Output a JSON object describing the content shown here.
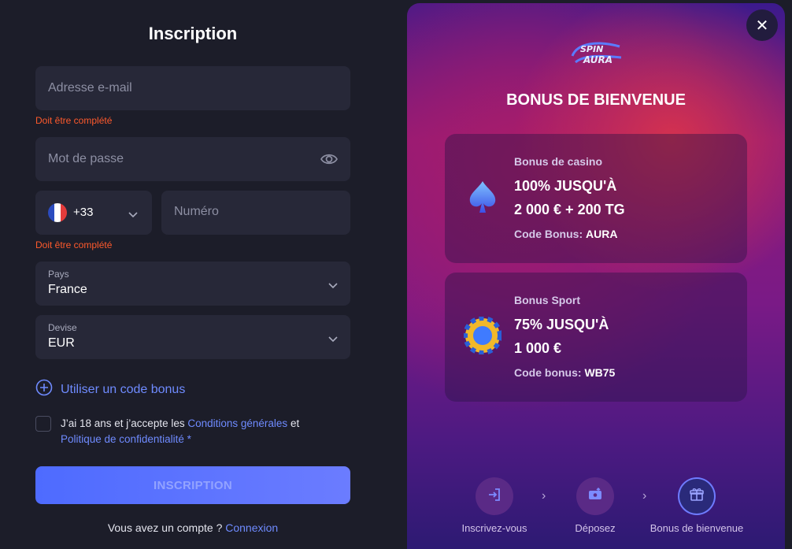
{
  "form": {
    "title": "Inscription",
    "email_placeholder": "Adresse e-mail",
    "email_error": "Doit être complété",
    "password_placeholder": "Mot de passe",
    "phone_code": "+33",
    "phone_placeholder": "Numéro",
    "phone_error": "Doit être complété",
    "country_label": "Pays",
    "country_value": "France",
    "currency_label": "Devise",
    "currency_value": "EUR",
    "bonus_code_link": "Utiliser un code bonus",
    "terms_prefix": "J’ai 18 ans et j’accepte les ",
    "terms_link1": "Conditions générales",
    "terms_mid": " et ",
    "terms_link2": "Politique de confidentialité *",
    "submit_label": "INSCRIPTION",
    "login_prefix": "Vous avez un compte ? ",
    "login_link": "Connexion"
  },
  "promo": {
    "close_icon": "close-icon",
    "logo_text_top": "SPIN",
    "logo_text_bottom": "AURA",
    "title": "BONUS DE BIENVENUE",
    "cards": [
      {
        "icon": "spade-icon",
        "type": "Bonus de casino",
        "line1": "100% JUSQU'À",
        "line2": "2 000 € + 200 TG",
        "code_label": "Code Bonus: ",
        "code_value": "AURA"
      },
      {
        "icon": "chip-icon",
        "type": "Bonus Sport",
        "line1": "75% JUSQU'À",
        "line2": "1 000 €",
        "code_label": "Code bonus: ",
        "code_value": "WB75"
      }
    ],
    "steps": [
      {
        "label": "Inscrivez-vous",
        "icon": "login-icon"
      },
      {
        "label": "Déposez",
        "icon": "deposit-icon"
      },
      {
        "label": "Bonus de bienvenue",
        "icon": "gift-icon"
      }
    ]
  },
  "colors": {
    "background": "#1c1d29",
    "field": "#272838",
    "error": "#ff5a2c",
    "link": "#6f8bff",
    "button": "#5570ff"
  }
}
